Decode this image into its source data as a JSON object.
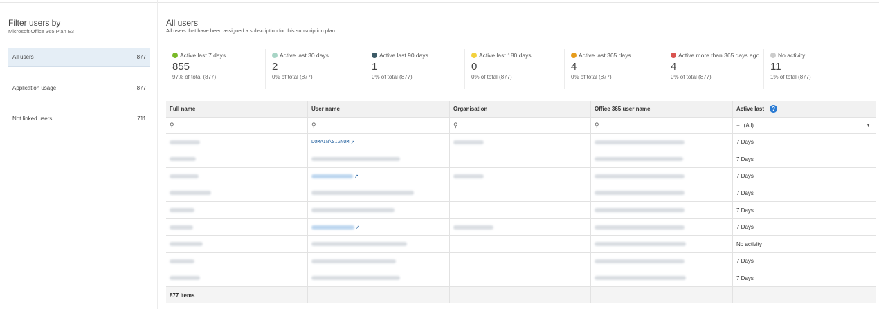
{
  "filter": {
    "title": "Filter users by",
    "subtitle": "Microsoft Office 365 Plan E3",
    "items": [
      {
        "label": "All users",
        "count": "877"
      },
      {
        "label": "Application usage",
        "count": "877"
      },
      {
        "label": "Not linked users",
        "count": "711"
      }
    ]
  },
  "main": {
    "title": "All users",
    "subtitle": "All users that have been assigned a subscription for this subscription plan."
  },
  "stats": [
    {
      "label": "Active last 7 days",
      "value": "855",
      "pct": "97% of total (877)",
      "color": "#7ab929"
    },
    {
      "label": "Active last 30 days",
      "value": "2",
      "pct": "0% of total (877)",
      "color": "#a8d5c6"
    },
    {
      "label": "Active last 90 days",
      "value": "1",
      "pct": "0% of total (877)",
      "color": "#3c5a66"
    },
    {
      "label": "Active last 180 days",
      "value": "0",
      "pct": "0% of total (877)",
      "color": "#f3d13d"
    },
    {
      "label": "Active last 365 days",
      "value": "4",
      "pct": "0% of total (877)",
      "color": "#e69c1c"
    },
    {
      "label": "Active more than 365 days ago",
      "value": "4",
      "pct": "0% of total (877)",
      "color": "#d9534f"
    },
    {
      "label": "No activity",
      "value": "11",
      "pct": "1% of total (877)",
      "color": "#cccccc"
    }
  ],
  "grid": {
    "columns": [
      "Full name",
      "User name",
      "Organisation",
      "Office 365 user name",
      "Active last"
    ],
    "filter_icon": "funnel-icon",
    "select_value": "(All)",
    "rows": [
      {
        "user_link": "DOMAIN\\SIGNUM",
        "active": "7 Days"
      },
      {
        "user_link": "",
        "active": "7 Days"
      },
      {
        "user_link": "",
        "active": "7 Days"
      },
      {
        "user_link": "",
        "active": "7 Days"
      },
      {
        "user_link": "",
        "active": "7 Days"
      },
      {
        "user_link": "",
        "active": "7 Days"
      },
      {
        "user_link": "",
        "active": "No activity"
      },
      {
        "user_link": "",
        "active": "7 Days"
      },
      {
        "user_link": "",
        "active": "7 Days"
      }
    ],
    "footer": "877 items"
  }
}
